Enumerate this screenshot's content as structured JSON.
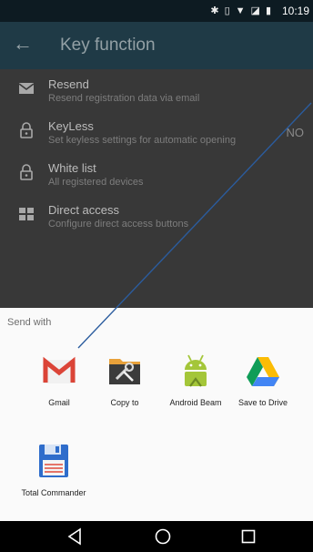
{
  "status_bar": {
    "time": "10:19",
    "icons": [
      "bluetooth-icon",
      "vibrate-icon",
      "wifi-icon",
      "no-sim-icon",
      "battery-icon"
    ]
  },
  "app_bar": {
    "title": "Key function"
  },
  "list": [
    {
      "icon": "email-icon",
      "title": "Resend",
      "subtitle": "Resend registration data via email"
    },
    {
      "icon": "lock-icon",
      "title": "KeyLess",
      "subtitle": "Set keyless settings for automatic opening",
      "toggle": "NO"
    },
    {
      "icon": "lock-icon",
      "title": "White list",
      "subtitle": "All registered devices"
    },
    {
      "icon": "grid-icon",
      "title": "Direct access",
      "subtitle": "Configure direct access buttons"
    }
  ],
  "share_sheet": {
    "heading": "Send with",
    "apps": [
      {
        "label": "Gmail",
        "icon": "gmail-icon"
      },
      {
        "label": "Copy to",
        "icon": "folder-tools-icon"
      },
      {
        "label": "Android Beam",
        "icon": "android-icon"
      },
      {
        "label": "Save to Drive",
        "icon": "drive-icon"
      },
      {
        "label": "Total Commander",
        "icon": "floppy-icon"
      }
    ]
  },
  "colors": {
    "app_bar": "#1f3a46",
    "gmail_red": "#db4437",
    "android_green": "#a4c639",
    "annotation_line": "#2b5c9e"
  }
}
